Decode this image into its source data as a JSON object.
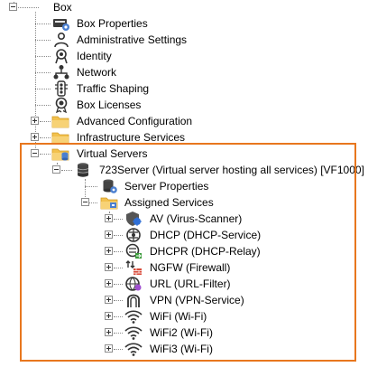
{
  "tree": {
    "root": {
      "label": "Box"
    },
    "box_children": [
      {
        "label": "Box Properties",
        "icon": "box-properties-icon"
      },
      {
        "label": "Administrative Settings",
        "icon": "admin-user-icon"
      },
      {
        "label": "Identity",
        "icon": "identity-icon"
      },
      {
        "label": "Network",
        "icon": "network-icon"
      },
      {
        "label": "Traffic Shaping",
        "icon": "traffic-light-icon"
      },
      {
        "label": "Box Licenses",
        "icon": "license-seal-icon"
      },
      {
        "label": "Advanced Configuration",
        "icon": "folder-icon",
        "expandable": true
      },
      {
        "label": "Infrastructure Services",
        "icon": "folder-icon",
        "expandable": true
      },
      {
        "label": "Virtual Servers",
        "icon": "folder-database-icon",
        "expanded": true
      }
    ],
    "virtual_server": {
      "label": "723Server (Virtual server hosting all services) [VF1000]"
    },
    "server_children": [
      {
        "label": "Server Properties"
      },
      {
        "label": "Assigned Services"
      }
    ],
    "services": [
      {
        "label": "AV (Virus-Scanner)",
        "icon": "virus-scanner-icon"
      },
      {
        "label": "DHCP (DHCP-Service)",
        "icon": "dhcp-icon"
      },
      {
        "label": "DHCPR (DHCP-Relay)",
        "icon": "dhcp-relay-icon"
      },
      {
        "label": "NGFW (Firewall)",
        "icon": "firewall-icon"
      },
      {
        "label": "URL (URL-Filter)",
        "icon": "url-filter-icon"
      },
      {
        "label": "VPN (VPN-Service)",
        "icon": "vpn-lock-icon"
      },
      {
        "label": "WiFi (Wi-Fi)",
        "icon": "wifi-icon"
      },
      {
        "label": "WiFi2 (Wi-Fi)",
        "icon": "wifi-icon"
      },
      {
        "label": "WiFi3 (Wi-Fi)",
        "icon": "wifi-icon"
      }
    ]
  },
  "colors": {
    "highlight_border": "#e8771e",
    "folder": "#f2c14e",
    "tree_line": "#8a8a8a"
  }
}
